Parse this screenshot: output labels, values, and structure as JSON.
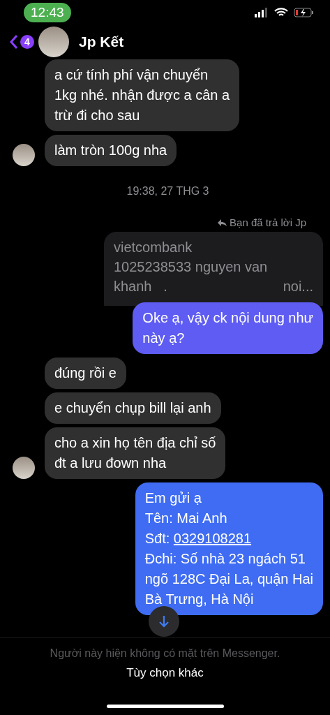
{
  "status_bar": {
    "time": "12:43"
  },
  "header": {
    "unread_count": "4",
    "contact_name": "Jp Kết"
  },
  "messages": [
    {
      "kind": "incoming",
      "avatar": false,
      "lines": [
        "a cứ tính phí vận chuyển",
        "1kg nhé. nhận được a cân a",
        "trừ đi cho sau"
      ]
    },
    {
      "kind": "incoming",
      "avatar": true,
      "lines": [
        "làm tròn 100g nha"
      ]
    },
    {
      "kind": "timestamp",
      "text": "19:38, 27 THG 3"
    },
    {
      "kind": "reply_note",
      "text": "Bạn đã trả lời Jp"
    },
    {
      "kind": "quote",
      "lines": [
        [
          "vietcombank"
        ],
        [
          "1025238533 nguyen van"
        ],
        [
          "khanh   .",
          "noi..."
        ]
      ]
    },
    {
      "kind": "outgoing",
      "color": "#5e5cf2",
      "lines": [
        "Oke ạ, vậy ck nội dung như",
        "này ạ?"
      ]
    },
    {
      "kind": "incoming",
      "avatar": false,
      "lines": [
        "đúng rồi e"
      ]
    },
    {
      "kind": "incoming",
      "avatar": false,
      "lines": [
        "e chuyển chụp bill lại anh"
      ]
    },
    {
      "kind": "incoming",
      "avatar": true,
      "lines": [
        "cho a xin họ tên địa chỉ số",
        "đt a lưu đown nha"
      ]
    },
    {
      "kind": "outgoing",
      "color": "#3f6cf2",
      "lines": [
        "Em gửi ạ",
        "Tên: Mai Anh",
        {
          "label": "Sđt: ",
          "link": "0329108281"
        },
        "Đchi: Số nhà 23 ngách 51",
        "ngõ 128C Đại La, quận Hai",
        "Bà Trưng, Hà Nội"
      ]
    }
  ],
  "footer": {
    "notice": "Người này hiện không có mặt trên Messenger.",
    "action": "Tùy chọn khác"
  }
}
